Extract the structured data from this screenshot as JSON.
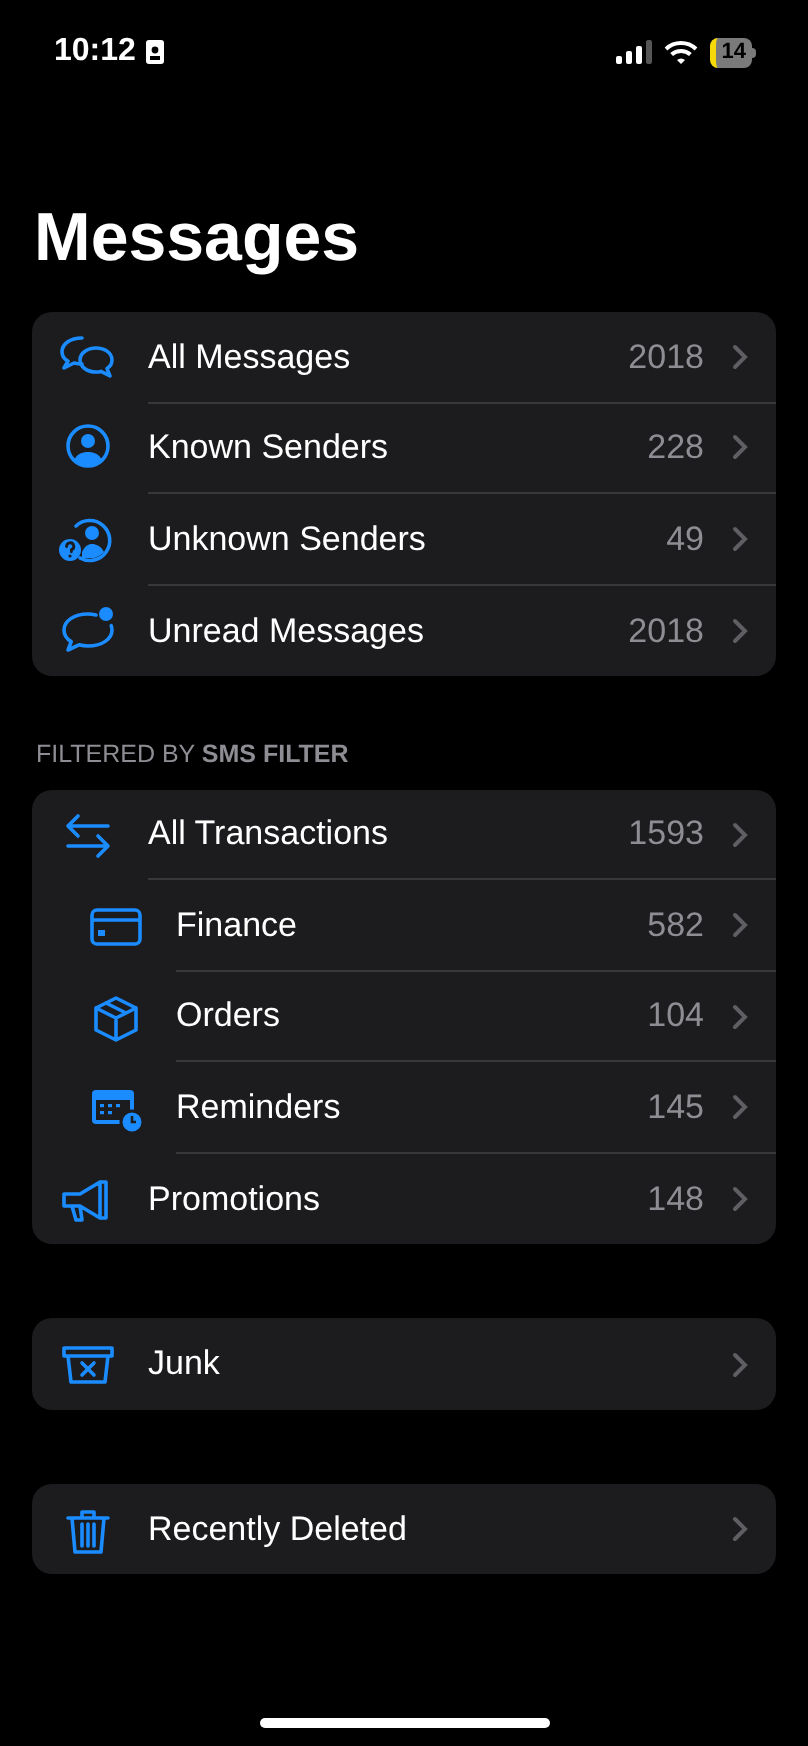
{
  "status_bar": {
    "time": "10:12",
    "battery": "14"
  },
  "title": "Messages",
  "groups": [
    {
      "items": [
        {
          "kind": "chat",
          "label": "All Messages",
          "count": "2018"
        },
        {
          "kind": "person",
          "label": "Known Senders",
          "count": "228"
        },
        {
          "kind": "unknown-person",
          "label": "Unknown Senders",
          "count": "49"
        },
        {
          "kind": "unread",
          "label": "Unread Messages",
          "count": "2018"
        }
      ]
    },
    {
      "header": "FILTERED BY **SMS FILTER**",
      "items": [
        {
          "kind": "arrows",
          "label": "All Transactions",
          "count": "1593",
          "children": [
            {
              "kind": "card",
              "label": "Finance",
              "count": "582"
            },
            {
              "kind": "box",
              "label": "Orders",
              "count": "104"
            },
            {
              "kind": "calendar",
              "label": "Reminders",
              "count": "145"
            }
          ]
        },
        {
          "kind": "megaphone",
          "label": "Promotions",
          "count": "148"
        }
      ]
    },
    {
      "items": [
        {
          "kind": "junk",
          "label": "Junk"
        }
      ]
    },
    {
      "items": [
        {
          "kind": "trash",
          "label": "Recently Deleted"
        }
      ]
    }
  ]
}
